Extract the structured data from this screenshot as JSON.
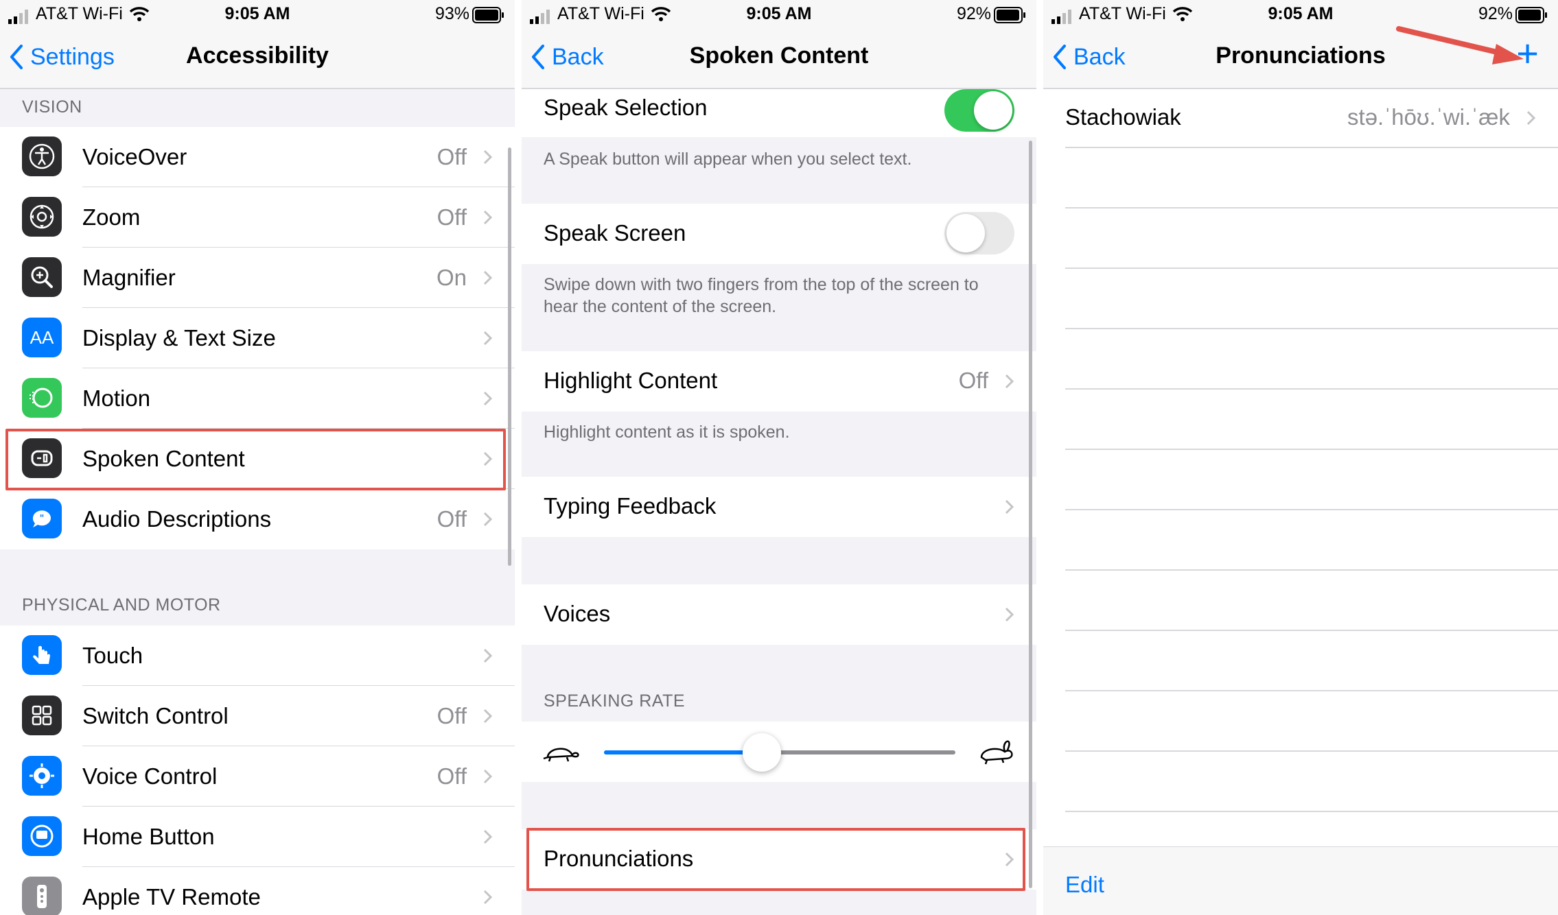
{
  "colors": {
    "accent": "#007aff",
    "highlight": "#e2534b",
    "toggle_on": "#34c759",
    "arrow": "#e2534b"
  },
  "panels": {
    "accessibility": {
      "status": {
        "carrier": "AT&T Wi-Fi",
        "time": "9:05 AM",
        "battery": "93%"
      },
      "nav": {
        "back": "Settings",
        "title": "Accessibility"
      },
      "vision_header": "VISION",
      "vision_items": [
        {
          "label": "VoiceOver",
          "value": "Off",
          "icon": "voiceover-icon"
        },
        {
          "label": "Zoom",
          "value": "Off",
          "icon": "zoom-icon"
        },
        {
          "label": "Magnifier",
          "value": "On",
          "icon": "magnifier-icon"
        },
        {
          "label": "Display & Text Size",
          "value": "",
          "icon": "text-size-icon"
        },
        {
          "label": "Motion",
          "value": "",
          "icon": "motion-icon"
        },
        {
          "label": "Spoken Content",
          "value": "",
          "icon": "spoken-content-icon"
        },
        {
          "label": "Audio Descriptions",
          "value": "Off",
          "icon": "audio-descriptions-icon"
        }
      ],
      "motor_header": "PHYSICAL AND MOTOR",
      "motor_items": [
        {
          "label": "Touch",
          "value": "",
          "icon": "touch-icon"
        },
        {
          "label": "Switch Control",
          "value": "Off",
          "icon": "switch-control-icon"
        },
        {
          "label": "Voice Control",
          "value": "Off",
          "icon": "voice-control-icon"
        },
        {
          "label": "Home Button",
          "value": "",
          "icon": "home-button-icon"
        },
        {
          "label": "Apple TV Remote",
          "value": "",
          "icon": "tv-remote-icon"
        }
      ]
    },
    "spoken_content": {
      "status": {
        "carrier": "AT&T Wi-Fi",
        "time": "9:05 AM",
        "battery": "92%"
      },
      "nav": {
        "back": "Back",
        "title": "Spoken Content"
      },
      "speak_selection": {
        "label": "Speak Selection",
        "on": true,
        "note": "A Speak button will appear when you select text."
      },
      "speak_screen": {
        "label": "Speak Screen",
        "on": false,
        "note": "Swipe down with two fingers from the top of the screen to hear the content of the screen."
      },
      "highlight_content": {
        "label": "Highlight Content",
        "value": "Off",
        "note": "Highlight content as it is spoken."
      },
      "typing_feedback": {
        "label": "Typing Feedback"
      },
      "voices": {
        "label": "Voices"
      },
      "speaking_rate": {
        "header": "SPEAKING RATE",
        "level": 0.45
      },
      "pronunciations": {
        "label": "Pronunciations"
      }
    },
    "pronunciations": {
      "status": {
        "carrier": "AT&T Wi-Fi",
        "time": "9:05 AM",
        "battery": "92%"
      },
      "nav": {
        "back": "Back",
        "title": "Pronunciations",
        "add": "+"
      },
      "entries": [
        {
          "word": "Stachowiak",
          "phonetic": "stə.ˈhōʊ.ˈwi.ˈæk"
        }
      ],
      "edit": "Edit"
    }
  }
}
